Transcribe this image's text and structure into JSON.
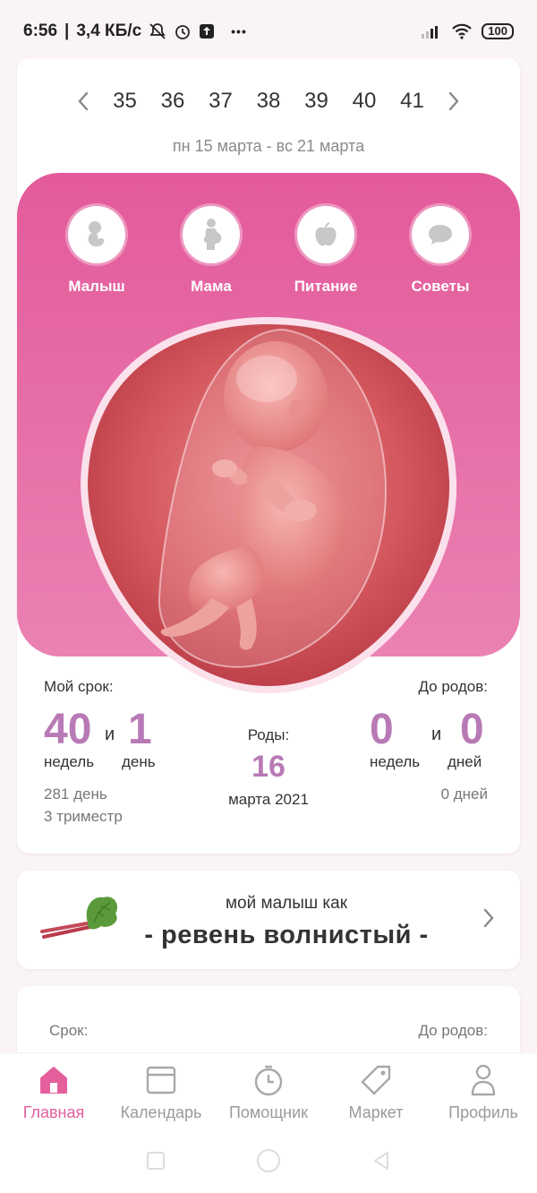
{
  "status": {
    "time": "6:56",
    "speed": "3,4 КБ/с",
    "more": "•••",
    "battery": "100"
  },
  "week": {
    "numbers": [
      "35",
      "36",
      "37",
      "38",
      "39",
      "40",
      "41"
    ],
    "range": "пн 15 марта - вс 21 марта"
  },
  "categories": [
    {
      "label": "Малыш",
      "icon": "baby-icon"
    },
    {
      "label": "Мама",
      "icon": "pregnant-woman-icon"
    },
    {
      "label": "Питание",
      "icon": "apple-icon"
    },
    {
      "label": "Советы",
      "icon": "chat-bubble-icon"
    }
  ],
  "term": {
    "label": "Мой срок:",
    "weeks": "40",
    "and": "и",
    "days": "1",
    "weeks_unit": "недель",
    "days_unit": "день",
    "total_days": "281 день",
    "trimester": "3 триместр"
  },
  "birth": {
    "label": "Роды:",
    "day": "16",
    "month_year": "марта 2021"
  },
  "until": {
    "label": "До родов:",
    "weeks": "0",
    "and": "и",
    "days": "0",
    "weeks_unit": "недель",
    "days_unit": "дней",
    "total_days": "0 дней"
  },
  "fruit": {
    "title": "мой малыш как",
    "name": "- ревень волнистый -"
  },
  "bottom_card": {
    "left": "Срок:",
    "right": "До родов:"
  },
  "nav": [
    {
      "label": "Главная",
      "icon": "home-icon",
      "active": true
    },
    {
      "label": "Календарь",
      "icon": "calendar-icon"
    },
    {
      "label": "Помощник",
      "icon": "timer-icon"
    },
    {
      "label": "Маркет",
      "icon": "tag-icon"
    },
    {
      "label": "Профиль",
      "icon": "profile-icon"
    }
  ],
  "colors": {
    "accent": "#e3609d",
    "numbers": "#b87ab6",
    "panel_top": "#e35a9a",
    "panel_bottom": "#ea82b3"
  }
}
